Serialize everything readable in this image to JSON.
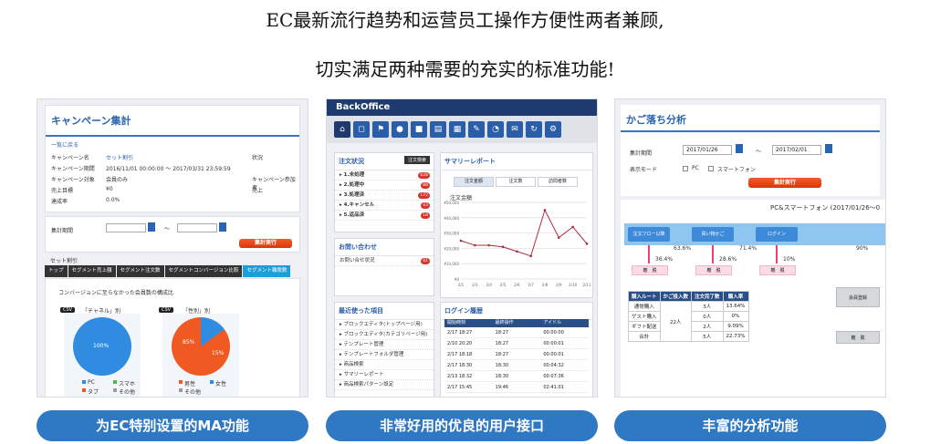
{
  "headline": {
    "line1": "EC最新流行趋势和运营员工操作方便性两者兼顾,",
    "line2": "切实满足两种需要的充实的标准功能!"
  },
  "panels": {
    "campaign": {
      "title": "キャンペーン集計",
      "back_link": "一覧に戻る",
      "fields": [
        {
          "k": "キャンペーン名",
          "v": "セット割引"
        },
        {
          "k": "キャンペーン期間",
          "v": "2016/11/01 00:00:00 〜 2017/03/31 23:59:59"
        },
        {
          "k": "キャンペーン対象",
          "v": "会員のみ"
        },
        {
          "k": "売上目標",
          "v": "¥0"
        },
        {
          "k": "達成率",
          "v": "0.0%"
        }
      ],
      "right_fields": [
        "状況",
        "キャンペーン参加者",
        "売上"
      ],
      "period_label": "集計期間",
      "tilde": "〜",
      "run_button": "集計実行",
      "set_label": "セット割引",
      "tabs": [
        "トップ",
        "セグメント売上額",
        "セグメント注文数",
        "セグメントコンバージョン比較",
        "セグメント離脱数"
      ],
      "pie_caption": "コンバージョンに至らなかった会員数の構成比",
      "csv": "CSV",
      "pie1_title": "「チャネル」別",
      "pie1_label": "100%",
      "pie2_title": "「性別」別",
      "pie2_labels": [
        "85%",
        "15%"
      ],
      "legend1": [
        "PC",
        "スマホ",
        "タブ",
        "その他"
      ],
      "legend2": [
        "男性",
        "女性",
        "その他"
      ],
      "colors": {
        "blue": "#2f8ce0",
        "orange": "#f05a22",
        "green": "#4cbb4c"
      }
    },
    "backoffice": {
      "logo": "BackOffice",
      "order_title": "注文状況",
      "order_btn": "注文検索",
      "orders": [
        {
          "label": "1.未処理",
          "badge": "628"
        },
        {
          "label": "2.処理中",
          "badge": "88"
        },
        {
          "label": "3.処理済",
          "badge": "172"
        },
        {
          "label": "4.キャンセル",
          "badge": "43"
        },
        {
          "label": "5.返品済",
          "badge": "18"
        }
      ],
      "inquiry_title": "お問い合わせ",
      "inquiry_item": "お問い合せ状況",
      "inquiry_badge": "61",
      "recent_title": "最近使った項目",
      "recent_items": [
        "ブロックエディタ(トップページ用)",
        "ブロックエディタ(カテゴリページ用)",
        "テンプレート管理",
        "テンプレートフォルダ管理",
        "商品検索",
        "サマリーレポート",
        "商品検索パターン設定"
      ],
      "report_title": "サマリーレポート",
      "report_tabs": [
        "注文金額",
        "注文数",
        "訪問者数"
      ],
      "chart_ylabel": "注文金額",
      "login_title": "ログイン履歴",
      "login_head": [
        "開始時刻",
        "最終操作",
        "アイドル"
      ],
      "login_rows": [
        [
          "2/17 18:27",
          "18:27",
          "00:00:00"
        ],
        [
          "2/10 20:20",
          "18:27",
          "00:00:01"
        ],
        [
          "2/17 18:18",
          "18:27",
          "00:00:01"
        ],
        [
          "2/17 18:30",
          "18:30",
          "00:04:32"
        ],
        [
          "2/13 18:32",
          "18:30",
          "00:07:36"
        ],
        [
          "2/17 15:45",
          "19:46",
          "02:41:01"
        ]
      ]
    },
    "cart": {
      "title": "かご落ち分析",
      "period_label": "集計期間",
      "date_from": "2017/01/26",
      "date_to": "2017/02/01",
      "tilde": "〜",
      "mode_label": "表示モード",
      "mode_pc": "PC",
      "mode_sp": "スマートフォン",
      "run_button": "集計実行",
      "chart_title": "PC&スマートフォン (2017/01/26〜0",
      "flow": [
        "注文フロー以降",
        "買い物かご",
        "ログイン"
      ],
      "flow_pct": [
        "63.6%",
        "71.4%",
        "90%"
      ],
      "drop_pct": [
        "36.4%",
        "28.6%",
        "10%"
      ],
      "drop_label": "離　脱",
      "table_head": [
        "購入ルート",
        "かご投入数",
        "注文完了数",
        "購入率"
      ],
      "table_rows": [
        [
          "通常購入",
          "22人",
          "3人",
          "13.64%"
        ],
        [
          "ゲスト購入",
          "",
          "0人",
          "0%"
        ],
        [
          "ギフト配送",
          "",
          "2人",
          "9.09%"
        ],
        [
          "合計",
          "",
          "5人",
          "22.73%"
        ]
      ],
      "side_btn1": "会員登録",
      "side_btn2": "離　脱"
    }
  },
  "buttons": [
    "为EC特别设置的MA功能",
    "非常好用的优良的用户接口",
    "丰富的分析功能"
  ],
  "chart_data": {
    "type": "line",
    "title": "",
    "ylabel": "注文金額",
    "x": [
      "2/1",
      "2/3",
      "2/4",
      "2/5",
      "2/6",
      "2/7",
      "2/8",
      "2/9",
      "2/10",
      "2/11"
    ],
    "series": [
      {
        "values": [
          25000,
          22000,
          22000,
          21000,
          18000,
          15000,
          45000,
          27000,
          34000,
          23000
        ]
      }
    ],
    "ylim": [
      0,
      50000
    ]
  }
}
